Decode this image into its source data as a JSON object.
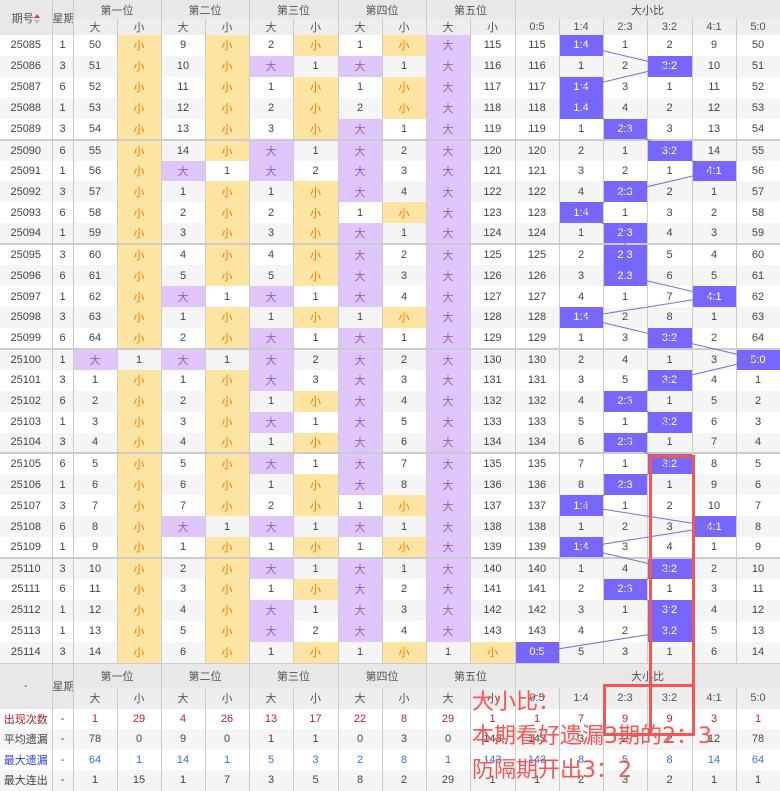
{
  "header": {
    "issue": "期号",
    "weekday": "星期",
    "positions": [
      "第一位",
      "第二位",
      "第三位",
      "第四位",
      "第五位"
    ],
    "big": "大",
    "small": "小",
    "ratio_title": "大小比",
    "ratios": [
      "0:5",
      "1:4",
      "2:3",
      "3:2",
      "4:1",
      "5:0"
    ]
  },
  "rows": [
    [
      "25085",
      "1",
      "50",
      "小",
      "9",
      "小",
      "2",
      "小",
      "1",
      "小",
      "大",
      "115",
      "115",
      "1:4",
      "1",
      "2",
      "9",
      "50"
    ],
    [
      "25086",
      "3",
      "51",
      "小",
      "10",
      "小",
      "大",
      "1",
      "大",
      "1",
      "大",
      "116",
      "116",
      "1",
      "2",
      "3:2",
      "10",
      "51"
    ],
    [
      "25087",
      "6",
      "52",
      "小",
      "11",
      "小",
      "1",
      "小",
      "1",
      "小",
      "大",
      "117",
      "117",
      "1:4",
      "3",
      "1",
      "11",
      "52"
    ],
    [
      "25088",
      "1",
      "53",
      "小",
      "12",
      "小",
      "2",
      "小",
      "2",
      "小",
      "大",
      "118",
      "118",
      "1:4",
      "4",
      "2",
      "12",
      "53"
    ],
    [
      "25089",
      "3",
      "54",
      "小",
      "13",
      "小",
      "3",
      "小",
      "大",
      "1",
      "大",
      "119",
      "119",
      "1",
      "2:3",
      "3",
      "13",
      "54"
    ],
    [
      "25090",
      "6",
      "55",
      "小",
      "14",
      "小",
      "大",
      "1",
      "大",
      "2",
      "大",
      "120",
      "120",
      "2",
      "1",
      "3:2",
      "14",
      "55"
    ],
    [
      "25091",
      "1",
      "56",
      "小",
      "大",
      "1",
      "大",
      "2",
      "大",
      "3",
      "大",
      "121",
      "121",
      "3",
      "2",
      "1",
      "4:1",
      "56"
    ],
    [
      "25092",
      "3",
      "57",
      "小",
      "1",
      "小",
      "1",
      "小",
      "大",
      "4",
      "大",
      "122",
      "122",
      "4",
      "2:3",
      "2",
      "1",
      "57"
    ],
    [
      "25093",
      "6",
      "58",
      "小",
      "2",
      "小",
      "2",
      "小",
      "1",
      "小",
      "大",
      "123",
      "123",
      "1:4",
      "1",
      "3",
      "2",
      "58"
    ],
    [
      "25094",
      "1",
      "59",
      "小",
      "3",
      "小",
      "3",
      "小",
      "大",
      "1",
      "大",
      "124",
      "124",
      "1",
      "2:3",
      "4",
      "3",
      "59"
    ],
    [
      "25095",
      "3",
      "60",
      "小",
      "4",
      "小",
      "4",
      "小",
      "大",
      "2",
      "大",
      "125",
      "125",
      "2",
      "2:3",
      "5",
      "4",
      "60"
    ],
    [
      "25096",
      "6",
      "61",
      "小",
      "5",
      "小",
      "5",
      "小",
      "大",
      "3",
      "大",
      "126",
      "126",
      "3",
      "2:3",
      "6",
      "5",
      "61"
    ],
    [
      "25097",
      "1",
      "62",
      "小",
      "大",
      "1",
      "大",
      "1",
      "大",
      "4",
      "大",
      "127",
      "127",
      "4",
      "1",
      "7",
      "4:1",
      "62"
    ],
    [
      "25098",
      "3",
      "63",
      "小",
      "1",
      "小",
      "1",
      "小",
      "1",
      "小",
      "大",
      "128",
      "128",
      "1:4",
      "2",
      "8",
      "1",
      "63"
    ],
    [
      "25099",
      "6",
      "64",
      "小",
      "2",
      "小",
      "大",
      "1",
      "大",
      "1",
      "大",
      "129",
      "129",
      "1",
      "3",
      "3:2",
      "2",
      "64"
    ],
    [
      "25100",
      "1",
      "大",
      "1",
      "大",
      "1",
      "大",
      "2",
      "大",
      "2",
      "大",
      "130",
      "130",
      "2",
      "4",
      "1",
      "3",
      "5:0"
    ],
    [
      "25101",
      "3",
      "1",
      "小",
      "1",
      "小",
      "大",
      "3",
      "大",
      "3",
      "大",
      "131",
      "131",
      "3",
      "5",
      "3:2",
      "4",
      "1"
    ],
    [
      "25102",
      "6",
      "2",
      "小",
      "2",
      "小",
      "1",
      "小",
      "大",
      "4",
      "大",
      "132",
      "132",
      "4",
      "2:3",
      "1",
      "5",
      "2"
    ],
    [
      "25103",
      "1",
      "3",
      "小",
      "3",
      "小",
      "大",
      "1",
      "大",
      "5",
      "大",
      "133",
      "133",
      "5",
      "1",
      "3:2",
      "6",
      "3"
    ],
    [
      "25104",
      "3",
      "4",
      "小",
      "4",
      "小",
      "1",
      "小",
      "大",
      "6",
      "大",
      "134",
      "134",
      "6",
      "2:3",
      "1",
      "7",
      "4"
    ],
    [
      "25105",
      "6",
      "5",
      "小",
      "5",
      "小",
      "大",
      "1",
      "大",
      "7",
      "大",
      "135",
      "135",
      "7",
      "1",
      "3:2",
      "8",
      "5"
    ],
    [
      "25106",
      "1",
      "6",
      "小",
      "6",
      "小",
      "1",
      "小",
      "大",
      "8",
      "大",
      "136",
      "136",
      "8",
      "2:3",
      "1",
      "9",
      "6"
    ],
    [
      "25107",
      "3",
      "7",
      "小",
      "7",
      "小",
      "2",
      "小",
      "1",
      "小",
      "大",
      "137",
      "137",
      "1:4",
      "1",
      "2",
      "10",
      "7"
    ],
    [
      "25108",
      "6",
      "8",
      "小",
      "大",
      "1",
      "大",
      "1",
      "大",
      "1",
      "大",
      "138",
      "138",
      "1",
      "2",
      "3",
      "4:1",
      "8"
    ],
    [
      "25109",
      "1",
      "9",
      "小",
      "1",
      "小",
      "1",
      "小",
      "1",
      "小",
      "大",
      "139",
      "139",
      "1:4",
      "3",
      "4",
      "1",
      "9"
    ],
    [
      "25110",
      "3",
      "10",
      "小",
      "2",
      "小",
      "大",
      "1",
      "大",
      "1",
      "大",
      "140",
      "140",
      "1",
      "4",
      "3:2",
      "2",
      "10"
    ],
    [
      "25111",
      "6",
      "11",
      "小",
      "3",
      "小",
      "1",
      "小",
      "大",
      "2",
      "大",
      "141",
      "141",
      "2",
      "2:3",
      "1",
      "3",
      "11"
    ],
    [
      "25112",
      "1",
      "12",
      "小",
      "4",
      "小",
      "大",
      "1",
      "大",
      "3",
      "大",
      "142",
      "142",
      "3",
      "1",
      "3:2",
      "4",
      "12"
    ],
    [
      "25113",
      "1",
      "13",
      "小",
      "5",
      "小",
      "大",
      "2",
      "大",
      "4",
      "大",
      "143",
      "143",
      "4",
      "2",
      "3:2",
      "5",
      "13"
    ],
    [
      "25114",
      "3",
      "14",
      "小",
      "6",
      "小",
      "1",
      "小",
      "1",
      "小",
      "1",
      "小",
      "0:5",
      "5",
      "3",
      "1",
      "6",
      "14"
    ]
  ],
  "footer": {
    "dash": "-",
    "stats": [
      {
        "label": "出现次数",
        "values": [
          "1",
          "29",
          "4",
          "26",
          "13",
          "17",
          "22",
          "8",
          "29",
          "1",
          "1",
          "7",
          "9",
          "9",
          "3",
          "1"
        ]
      },
      {
        "label": "平均遗漏",
        "values": [
          "78",
          "0",
          "9",
          "0",
          "1",
          "1",
          "0",
          "3",
          "0",
          "143",
          "143",
          "3",
          "2",
          "2",
          "12",
          "78"
        ]
      },
      {
        "label": "最大遗漏",
        "values": [
          "64",
          "1",
          "14",
          "1",
          "5",
          "3",
          "2",
          "8",
          "1",
          "143",
          "143",
          "8",
          "5",
          "8",
          "14",
          "64"
        ]
      },
      {
        "label": "最大连出",
        "values": [
          "1",
          "15",
          "1",
          "7",
          "3",
          "5",
          "8",
          "2",
          "29",
          "1",
          "1",
          "2",
          "3",
          "2",
          "1",
          "1"
        ]
      }
    ]
  },
  "annotation": {
    "line1": "大小比：",
    "line2": "本期看好遗漏3期的2：3",
    "line3": "防隔期开出3：2"
  },
  "colors": {
    "big": "#dfc6fb",
    "small": "#fde4a2",
    "hit": "#7766ff",
    "annotation": "#f45555"
  }
}
